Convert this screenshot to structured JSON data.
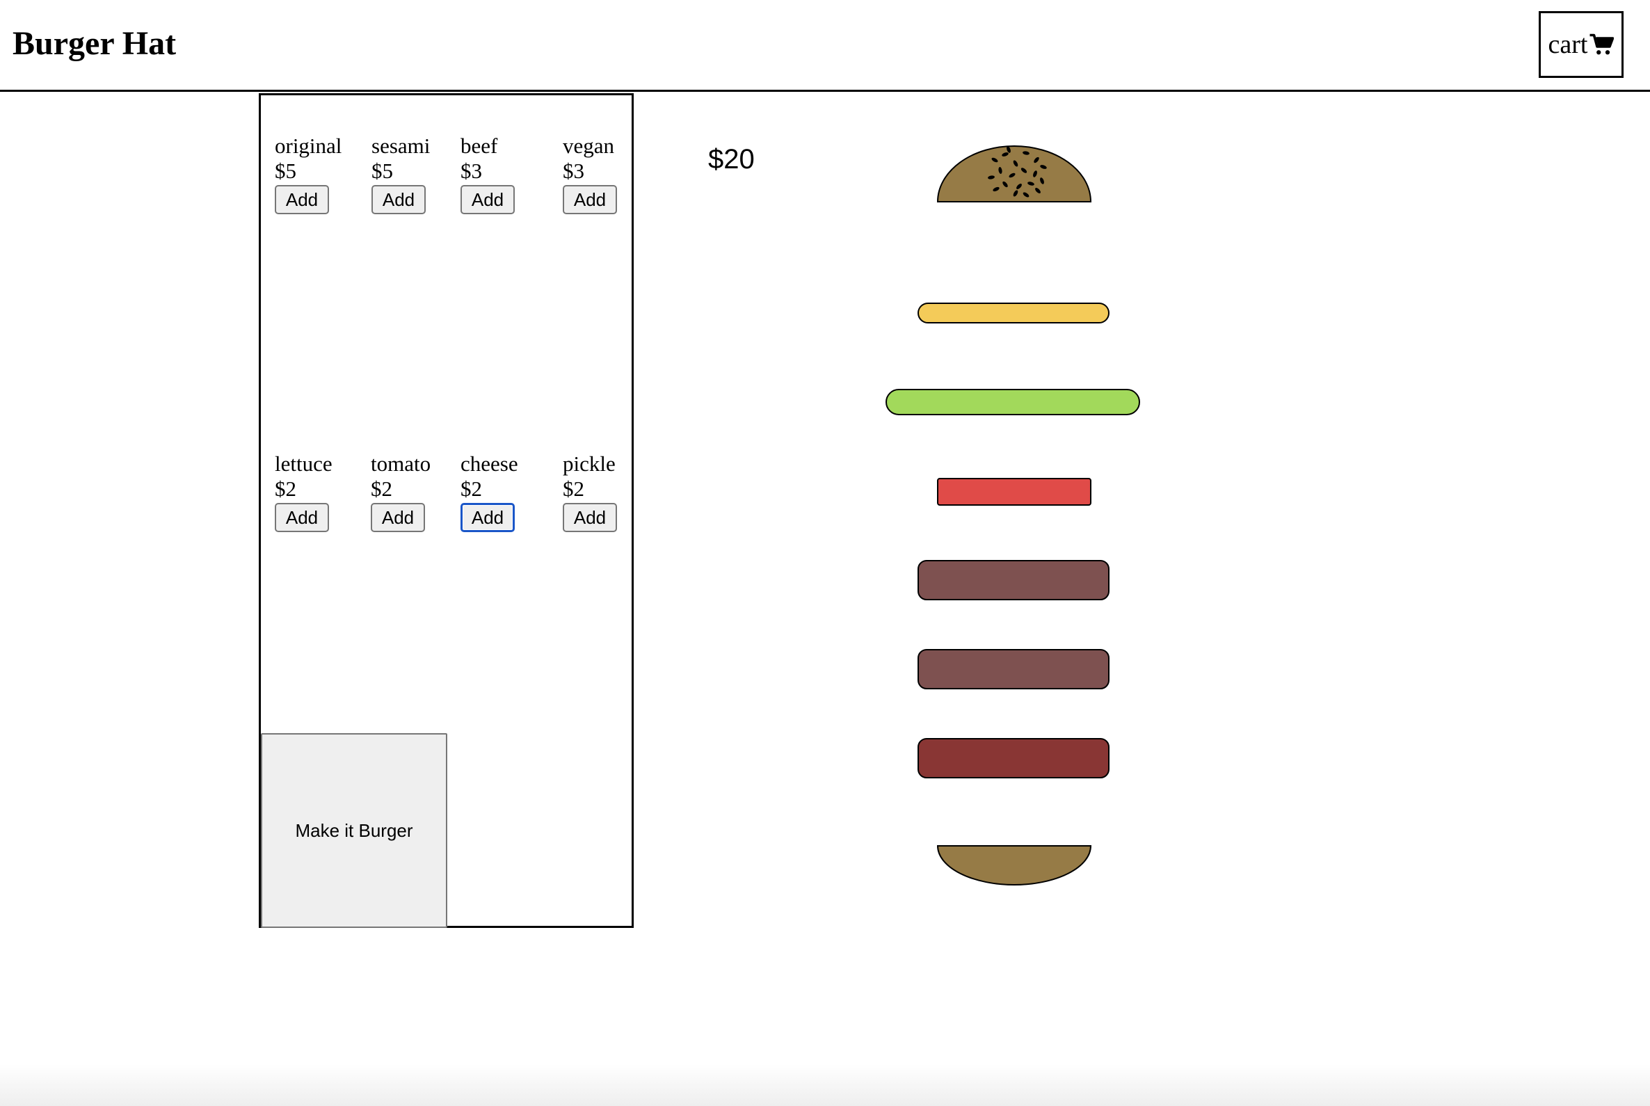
{
  "header": {
    "brand": "Burger Hat",
    "cart_label": "cart",
    "cart_icon": "shopping-cart-icon"
  },
  "menu": {
    "buns": [
      {
        "name": "original",
        "price": "$5",
        "button": "Add"
      },
      {
        "name": "sesami",
        "price": "$5",
        "button": "Add"
      }
    ],
    "patties": [
      {
        "name": "beef",
        "price": "$3",
        "button": "Add"
      },
      {
        "name": "vegan",
        "price": "$3",
        "button": "Add"
      }
    ],
    "toppings": [
      {
        "name": "lettuce",
        "price": "$2",
        "button": "Add"
      },
      {
        "name": "tomato",
        "price": "$2",
        "button": "Add"
      },
      {
        "name": "cheese",
        "price": "$2",
        "button": "Add",
        "focused": true
      },
      {
        "name": "pickle",
        "price": "$2",
        "button": "Add"
      }
    ],
    "make_button": "Make it Burger"
  },
  "summary": {
    "total": "$20"
  },
  "burger_stack": {
    "layers_top_to_bottom": [
      "sesami-top-bun",
      "cheese",
      "lettuce",
      "tomato",
      "vegan-patty",
      "vegan-patty",
      "beef-patty",
      "bottom-bun"
    ],
    "colors": {
      "bun": "#967b46",
      "cheese": "#f4cb59",
      "lettuce": "#a2d95b",
      "tomato": "#e04b48",
      "vegan_patty": "#7e5150",
      "beef_patty": "#893634",
      "outline": "#000000"
    }
  }
}
